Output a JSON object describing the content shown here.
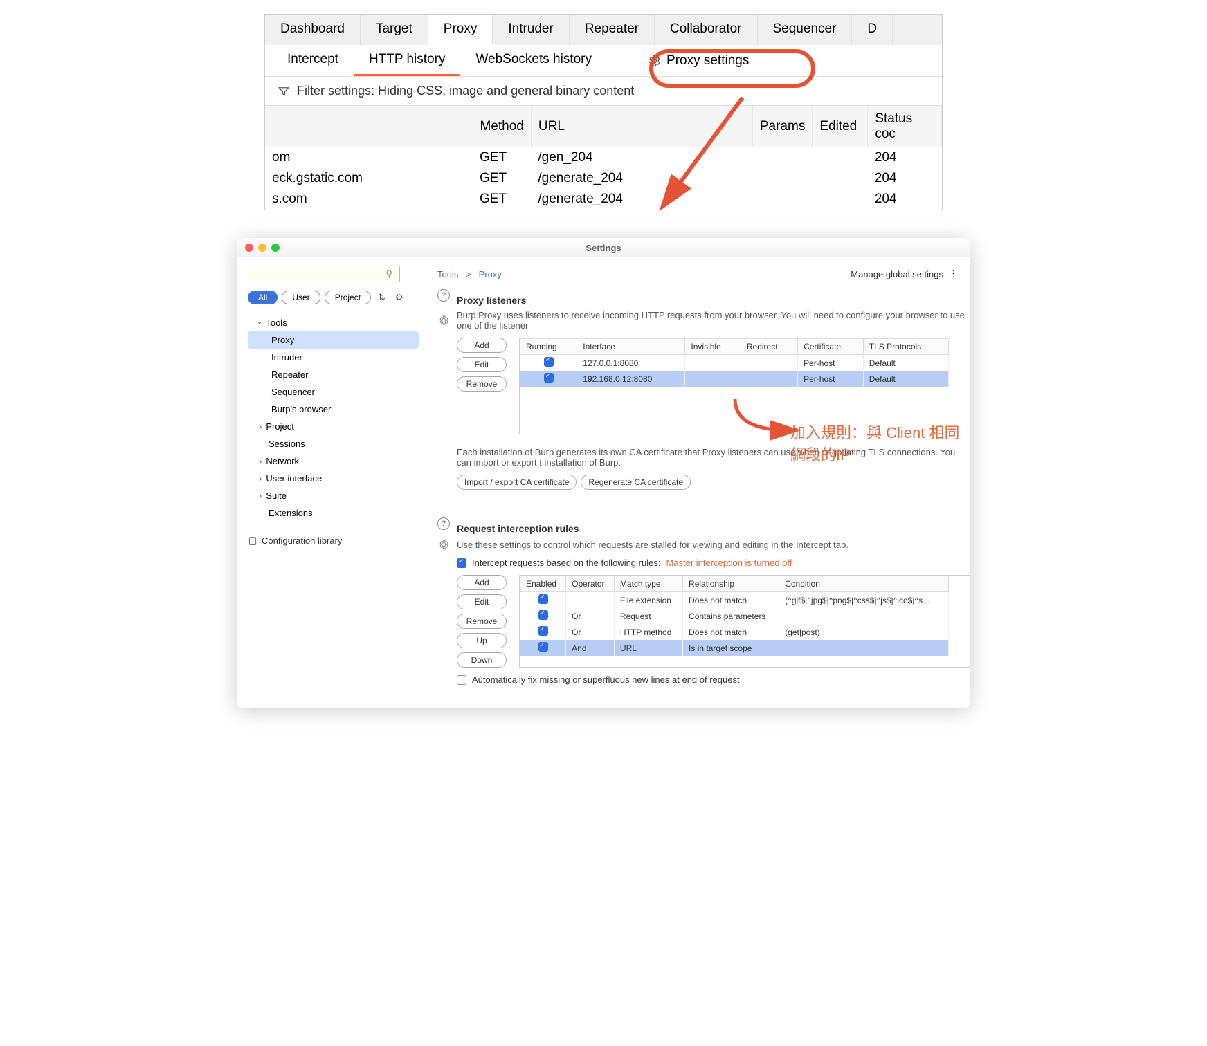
{
  "main_tabs": [
    "Dashboard",
    "Target",
    "Proxy",
    "Intruder",
    "Repeater",
    "Collaborator",
    "Sequencer",
    "D"
  ],
  "main_active": "Proxy",
  "sub_tabs": [
    "Intercept",
    "HTTP history",
    "WebSockets history"
  ],
  "sub_active": "HTTP history",
  "proxy_settings_label": "Proxy settings",
  "filter_text": "Filter settings: Hiding CSS, image and general binary content",
  "hist_cols": [
    "",
    "Method",
    "URL",
    "Params",
    "Edited",
    "Status coc"
  ],
  "hist_rows": [
    {
      "host": "om",
      "method": "GET",
      "url": "/gen_204",
      "status": "204"
    },
    {
      "host": "eck.gstatic.com",
      "method": "GET",
      "url": "/generate_204",
      "status": "204"
    },
    {
      "host": "s.com",
      "method": "GET",
      "url": "/generate_204",
      "status": "204"
    }
  ],
  "settings_title": "Settings",
  "crumbs": {
    "first": "Tools",
    "sep": ">",
    "last": "Proxy"
  },
  "manage_label": "Manage global settings",
  "pills": [
    "All",
    "User",
    "Project"
  ],
  "pill_active": "All",
  "nav": {
    "tools_label": "Tools",
    "tools": [
      "Proxy",
      "Intruder",
      "Repeater",
      "Sequencer",
      "Burp's browser"
    ],
    "tools_active": "Proxy",
    "others": [
      "Project",
      "Sessions",
      "Network",
      "User interface",
      "Suite",
      "Extensions"
    ]
  },
  "config_lib": "Configuration library",
  "sec1": {
    "title": "Proxy listeners",
    "desc": "Burp Proxy uses listeners to receive incoming HTTP requests from your browser. You will need to configure your browser to use one of the listener",
    "buttons": [
      "Add",
      "Edit",
      "Remove"
    ],
    "cols": [
      "Running",
      "Interface",
      "Invisible",
      "Redirect",
      "Certificate",
      "TLS Protocols"
    ],
    "rows": [
      {
        "run": true,
        "iface": "127.0.0.1:8080",
        "inv": "",
        "redir": "",
        "cert": "Per-host",
        "tls": "Default",
        "sel": false
      },
      {
        "run": true,
        "iface": "192.168.0.12:8080",
        "inv": "",
        "redir": "",
        "cert": "Per-host",
        "tls": "Default",
        "sel": true
      }
    ],
    "note": "Each installation of Burp generates its own CA certificate that Proxy listeners can use when negotiating TLS connections. You can import or export t installation of Burp.",
    "cert_btns": [
      "Import / export CA certificate",
      "Regenerate CA certificate"
    ]
  },
  "sec2": {
    "title": "Request interception rules",
    "desc": "Use these settings to control which requests are stalled for viewing and editing in the Intercept tab.",
    "check_label": "Intercept requests based on the following rules:",
    "master_label": "Master interception is turned off",
    "buttons": [
      "Add",
      "Edit",
      "Remove",
      "Up",
      "Down"
    ],
    "cols": [
      "Enabled",
      "Operator",
      "Match type",
      "Relationship",
      "Condition"
    ],
    "rows": [
      {
        "en": true,
        "op": "",
        "mt": "File extension",
        "rel": "Does not match",
        "cond": "(^gif$|^jpg$|^png$|^css$|^js$|^ico$|^s...",
        "sel": false
      },
      {
        "en": true,
        "op": "Or",
        "mt": "Request",
        "rel": "Contains parameters",
        "cond": "",
        "sel": false
      },
      {
        "en": true,
        "op": "Or",
        "mt": "HTTP method",
        "rel": "Does not match",
        "cond": "(get|post)",
        "sel": false
      },
      {
        "en": true,
        "op": "And",
        "mt": "URL",
        "rel": "Is in target scope",
        "cond": "",
        "sel": true
      }
    ],
    "autofix": "Automatically fix missing or superfluous new lines at end of request"
  },
  "annotation": "加入規則：與 Client 相同網段的IP"
}
